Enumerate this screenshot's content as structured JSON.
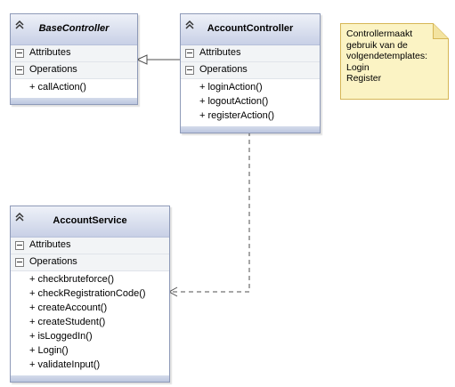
{
  "classes": {
    "base": {
      "name": "BaseController",
      "attributes_label": "Attributes",
      "operations_label": "Operations",
      "operations": [
        "+ callAction()"
      ]
    },
    "account_controller": {
      "name": "AccountController",
      "attributes_label": "Attributes",
      "operations_label": "Operations",
      "operations": [
        "+ loginAction()",
        "+ logoutAction()",
        "+ registerAction()"
      ]
    },
    "account_service": {
      "name": "AccountService",
      "attributes_label": "Attributes",
      "operations_label": "Operations",
      "operations": [
        "+ checkbruteforce()",
        "+ checkRegistrationCode()",
        "+ createAccount()",
        "+ createStudent()",
        "+ isLoggedIn()",
        "+ Login()",
        "+ validateInput()"
      ]
    }
  },
  "note": {
    "lines": [
      "Controllermaakt",
      "gebruik van de",
      "volgendetemplates:",
      "Login",
      "Register"
    ]
  },
  "relations": [
    {
      "from": "AccountController",
      "to": "BaseController",
      "type": "generalization"
    },
    {
      "from": "AccountController",
      "to": "AccountService",
      "type": "dependency"
    }
  ],
  "colors": {
    "header_top": "#eef1f8",
    "header_bottom": "#c8d0e6",
    "border": "#8e9ab8",
    "note_fill": "#fbf3c4",
    "note_border": "#d6b656",
    "connector": "#4f4f4f"
  }
}
